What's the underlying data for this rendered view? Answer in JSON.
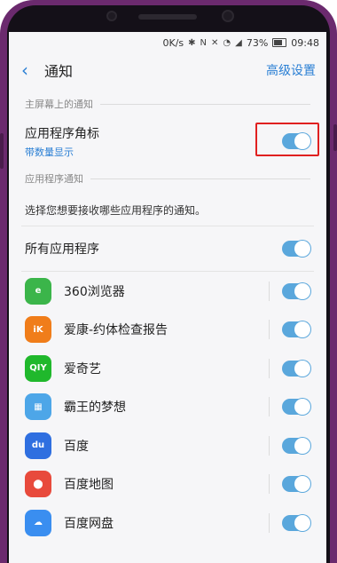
{
  "status_bar": {
    "speed": "0K/s",
    "battery": "73%",
    "time": "09:48"
  },
  "header": {
    "back_icon": "chevron-left-icon",
    "title": "通知",
    "advanced_label": "高级设置"
  },
  "section_lock": {
    "label": "主屏幕上的通知"
  },
  "badge_setting": {
    "label": "应用程序角标",
    "sublabel": "带数量显示",
    "enabled": true
  },
  "section_apps": {
    "label": "应用程序通知"
  },
  "description": "选择您想要接收哪些应用程序的通知。",
  "all_apps": {
    "label": "所有应用程序",
    "enabled": true
  },
  "apps": [
    {
      "name": "360浏览器",
      "icon": "360-browser-icon",
      "color": "#3bb54a",
      "enabled": true
    },
    {
      "name": "爱康-约体检查报告",
      "icon": "ikang-icon",
      "color": "#f07d1a",
      "enabled": true
    },
    {
      "name": "爱奇艺",
      "icon": "iqiyi-icon",
      "color": "#20b82c",
      "enabled": true
    },
    {
      "name": "霸王的梦想",
      "icon": "game-icon",
      "color": "#4da6e8",
      "enabled": true
    },
    {
      "name": "百度",
      "icon": "baidu-icon",
      "color": "#2f6fe0",
      "enabled": true
    },
    {
      "name": "百度地图",
      "icon": "baidu-map-icon",
      "color": "#e84a3c",
      "enabled": true
    },
    {
      "name": "百度网盘",
      "icon": "baidu-netdisk-icon",
      "color": "#3a8ef0",
      "enabled": true
    }
  ],
  "accent_color": "#2a7fd4",
  "toggle_color": "#5aa7dc",
  "highlight_color": "#e02020"
}
